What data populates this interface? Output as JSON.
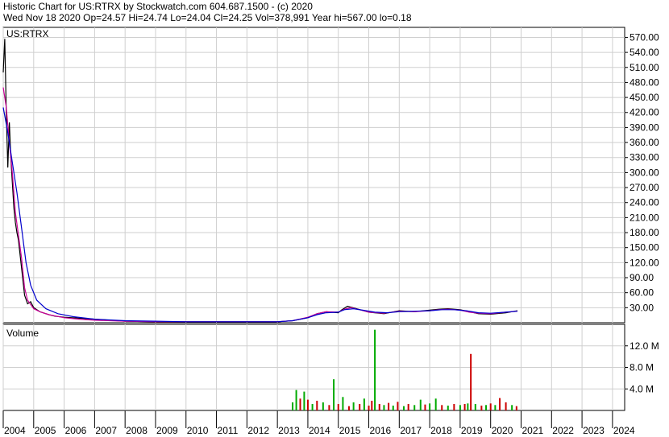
{
  "header": {
    "line1": "Historic Chart for US:RTRX by Stockwatch.com 604.687.1500 - (c) 2020",
    "line2": "Wed Nov 18 2020   Op=24.57   Hi=24.74   Lo=24.04   Cl=24.25   Vol=378,991   Year hi=567.00   lo=0.18"
  },
  "chart_data": [
    {
      "type": "line",
      "title": "US:RTRX",
      "ylim": [
        0,
        590
      ],
      "y_ticks": [
        "30.00",
        "60.00",
        "90.00",
        "120.00",
        "150.00",
        "180.00",
        "210.00",
        "240.00",
        "270.00",
        "300.00",
        "330.00",
        "360.00",
        "390.00",
        "420.00",
        "450.00",
        "480.00",
        "510.00",
        "540.00",
        "570.00"
      ],
      "x_ticks": [
        "2004",
        "2005",
        "2006",
        "2007",
        "2008",
        "2009",
        "2010",
        "2011",
        "2012",
        "2013",
        "2014",
        "2015",
        "2016",
        "2017",
        "2018",
        "2019",
        "2020",
        "2021",
        "2022",
        "2023",
        "2024"
      ],
      "grid": true,
      "series": [
        {
          "color": "#000000",
          "x": [
            2004.0,
            2004.05,
            2004.1,
            2004.15,
            2004.2,
            2004.25,
            2004.3,
            2004.35,
            2004.4,
            2004.45,
            2004.5,
            2004.6,
            2004.7,
            2004.8,
            2004.9,
            2005.0,
            2005.1,
            2005.2,
            2005.3,
            2005.5,
            2005.7,
            2006.0,
            2006.5,
            2007.0,
            2007.5,
            2008.0,
            2009.0,
            2010.0,
            2011.0,
            2012.0,
            2013.0,
            2013.5,
            2014.0,
            2014.3,
            2014.6,
            2015.0,
            2015.1,
            2015.3,
            2015.6,
            2016.0,
            2016.5,
            2017.0,
            2017.5,
            2018.0,
            2018.3,
            2018.6,
            2019.0,
            2019.3,
            2019.6,
            2020.0,
            2020.5,
            2020.88
          ],
          "values": [
            500,
            567,
            420,
            310,
            400,
            330,
            280,
            230,
            200,
            180,
            165,
            110,
            55,
            38,
            42,
            30,
            26,
            22,
            20,
            16,
            13,
            11,
            9,
            7,
            5,
            3,
            2,
            2,
            2,
            2,
            2,
            4,
            10,
            18,
            22,
            20,
            25,
            33,
            28,
            21,
            18,
            24,
            22,
            25,
            27,
            28,
            26,
            22,
            18,
            17,
            20,
            24
          ]
        },
        {
          "name": "",
          "color": "#cc0099",
          "x": [
            2004.0,
            2004.1,
            2004.2,
            2004.3,
            2004.4,
            2004.5,
            2004.6,
            2004.7,
            2004.8,
            2005.0,
            2005.2,
            2005.5,
            2006.0,
            2006.5,
            2007.0,
            2008.0,
            2009.0,
            2010.0,
            2011.0,
            2012.0,
            2013.0,
            2013.5,
            2014.0,
            2014.3,
            2014.6,
            2015.0,
            2015.2,
            2015.4,
            2015.7,
            2016.0,
            2016.5,
            2017.0,
            2017.5,
            2018.0,
            2018.3,
            2018.6,
            2019.0,
            2019.3,
            2019.6,
            2020.0,
            2020.5,
            2020.88
          ],
          "values": [
            470,
            430,
            360,
            300,
            220,
            175,
            130,
            70,
            45,
            28,
            22,
            16,
            10,
            7,
            5,
            3,
            2,
            2,
            2,
            2,
            2,
            4,
            11,
            18,
            22,
            21,
            27,
            30,
            26,
            21,
            19,
            23,
            22,
            24,
            26,
            27,
            25,
            21,
            19,
            18,
            21,
            23
          ]
        },
        {
          "name": "",
          "color": "#0000cc",
          "x": [
            2004.0,
            2004.15,
            2004.3,
            2004.45,
            2004.6,
            2004.75,
            2004.9,
            2005.1,
            2005.4,
            2005.8,
            2006.3,
            2007.0,
            2008.0,
            2009.0,
            2010.0,
            2011.0,
            2012.0,
            2013.0,
            2013.5,
            2014.0,
            2014.3,
            2014.6,
            2015.0,
            2015.2,
            2015.5,
            2015.8,
            2016.2,
            2016.6,
            2017.0,
            2017.5,
            2018.0,
            2018.4,
            2018.8,
            2019.2,
            2019.6,
            2020.0,
            2020.5,
            2020.88
          ],
          "values": [
            430,
            380,
            320,
            260,
            190,
            120,
            75,
            45,
            28,
            18,
            12,
            7,
            4,
            3,
            2,
            2,
            2,
            2,
            4,
            10,
            16,
            20,
            21,
            26,
            28,
            25,
            21,
            20,
            22,
            23,
            24,
            26,
            26,
            24,
            20,
            19,
            21,
            23
          ]
        }
      ]
    },
    {
      "type": "bar",
      "title": "Volume",
      "ylim": [
        0,
        16.0
      ],
      "y_ticks": [
        "4.0 M",
        "8.0 M",
        "12.0 M"
      ],
      "x": [
        2013.5,
        2013.62,
        2013.75,
        2013.88,
        2014.0,
        2014.15,
        2014.3,
        2014.5,
        2014.7,
        2014.85,
        2015.0,
        2015.15,
        2015.35,
        2015.5,
        2015.7,
        2015.85,
        2016.0,
        2016.1,
        2016.2,
        2016.35,
        2016.5,
        2016.65,
        2016.8,
        2016.95,
        2017.15,
        2017.3,
        2017.5,
        2017.7,
        2017.85,
        2018.0,
        2018.2,
        2018.4,
        2018.6,
        2018.8,
        2019.0,
        2019.15,
        2019.25,
        2019.35,
        2019.5,
        2019.7,
        2019.85,
        2020.0,
        2020.15,
        2020.3,
        2020.5,
        2020.7,
        2020.85
      ],
      "values": [
        1.5,
        3.8,
        2.2,
        3.5,
        2.0,
        1.2,
        1.8,
        1.5,
        1.0,
        5.8,
        1.2,
        2.5,
        0.8,
        1.5,
        1.2,
        2.2,
        0.9,
        1.8,
        15.0,
        1.2,
        1.0,
        1.4,
        0.9,
        1.6,
        0.8,
        1.2,
        1.0,
        2.0,
        1.1,
        1.3,
        2.2,
        1.0,
        0.9,
        1.2,
        1.0,
        1.2,
        1.3,
        10.5,
        1.2,
        0.9,
        1.0,
        1.3,
        1.0,
        2.3,
        1.5,
        1.0,
        0.8
      ],
      "colors": [
        "#00aa00",
        "#00aa00",
        "#cc0000",
        "#00aa00",
        "#cc0000",
        "#00aa00",
        "#cc0000",
        "#00aa00",
        "#cc0000",
        "#00aa00",
        "#cc0000",
        "#00aa00",
        "#cc0000",
        "#00aa00",
        "#cc0000",
        "#00aa00",
        "#cc0000",
        "#cc0000",
        "#00aa00",
        "#cc0000",
        "#00aa00",
        "#cc0000",
        "#00aa00",
        "#cc0000",
        "#00aa00",
        "#cc0000",
        "#00aa00",
        "#00aa00",
        "#cc0000",
        "#00aa00",
        "#00aa00",
        "#cc0000",
        "#00aa00",
        "#cc0000",
        "#00aa00",
        "#cc0000",
        "#00aa00",
        "#cc0000",
        "#00aa00",
        "#cc0000",
        "#00aa00",
        "#cc0000",
        "#00aa00",
        "#cc0000",
        "#cc0000",
        "#00aa00",
        "#cc0000"
      ]
    }
  ]
}
